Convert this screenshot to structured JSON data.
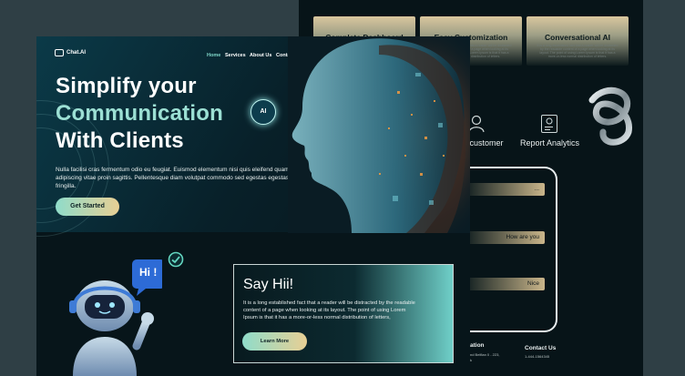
{
  "back_panel": {
    "cards": [
      {
        "title": "Complete Dashboard",
        "text": "It is a long established fact that a reader will be distracted by the readable content of a page when looking at its layout. The point of using Lorem Ipsum is that it has a more-or-less normal distribution of letters."
      },
      {
        "title": "Easy Customization",
        "text": "It is a long established fact that a reader will be distracted by the readable content of a page when looking at its layout. The point of using Lorem Ipsum is that it has a more-or-less normal distribution of letters."
      },
      {
        "title": "Conversational AI",
        "text": "It is a long established fact that a reader will be distracted by the readable content of a page when looking at its layout. The point of using Lorem Ipsum is that it has a more-or-less normal distribution of letters."
      }
    ],
    "features": {
      "left_label": "g customer",
      "right_label": "Report Analytics"
    },
    "chat_bubbles": [
      "...",
      "How are you",
      "Nice"
    ],
    "footer": {
      "col1_title": "ation",
      "col1_text": "nd Belfian 0 - 223,",
      "col1_text2": "k",
      "col2_title": "Contact Us",
      "col2_text": "1-444-1564345"
    }
  },
  "nav": {
    "logo": "Chat.AI",
    "items": [
      "Home",
      "Services",
      "About Us",
      "Contact us"
    ]
  },
  "hero": {
    "line1": "Simplify your",
    "line2": "Communication",
    "line3": "With Clients",
    "subtitle": "Nulla facilisi cras fermentum odio eu feugiat. Euismod elementum nisi quis eleifend quam adipiscing vitae proin sagittis. Pellentesque diam volutpat commodo sed egestas egestas fringilla.",
    "cta": "Get Started",
    "ai_badge": "AI"
  },
  "robot": {
    "bubble": "Hi !"
  },
  "say_hi": {
    "title": "Say Hii!",
    "text": "It is a long established fact that a reader will be distracted by the readable content of a page when looking at its layout. The point of using Lorem Ipsum is that it has a more-or-less normal distribution of letters,",
    "button": "Learn More"
  }
}
